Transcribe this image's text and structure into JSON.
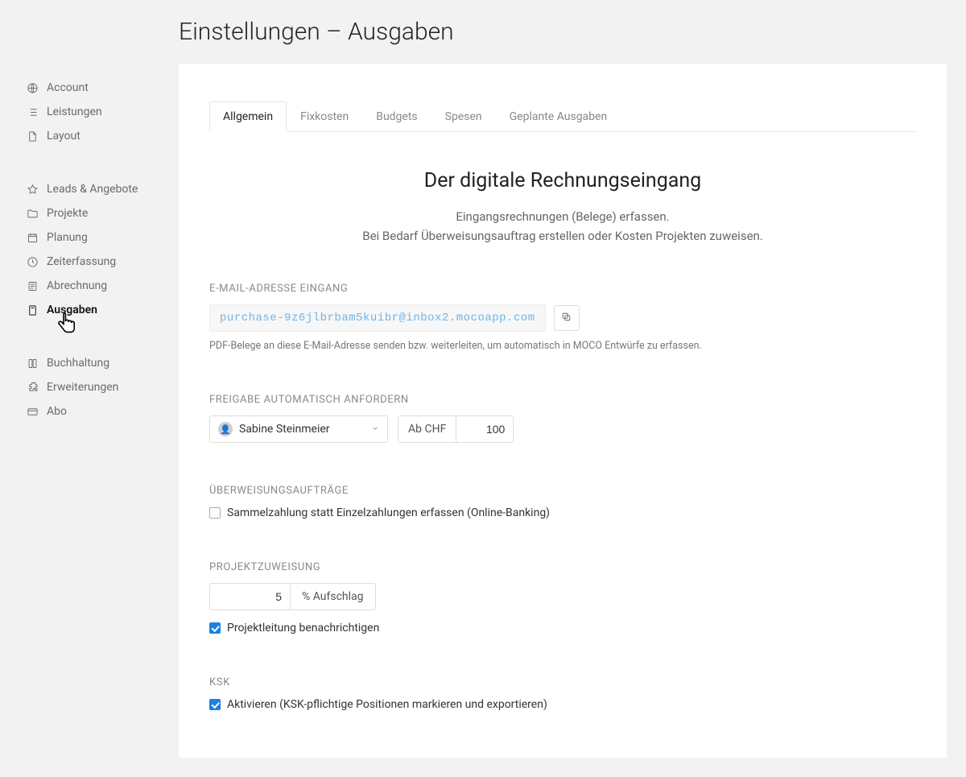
{
  "page_title": "Einstellungen – Ausgaben",
  "sidebar": {
    "group1": [
      {
        "label": "Account"
      },
      {
        "label": "Leistungen"
      },
      {
        "label": "Layout"
      }
    ],
    "group2": [
      {
        "label": "Leads & Angebote"
      },
      {
        "label": "Projekte"
      },
      {
        "label": "Planung"
      },
      {
        "label": "Zeiterfassung"
      },
      {
        "label": "Abrechnung"
      },
      {
        "label": "Ausgaben"
      }
    ],
    "group3": [
      {
        "label": "Buchhaltung"
      },
      {
        "label": "Erweiterungen"
      },
      {
        "label": "Abo"
      }
    ]
  },
  "tabs": [
    {
      "label": "Allgemein"
    },
    {
      "label": "Fixkosten"
    },
    {
      "label": "Budgets"
    },
    {
      "label": "Spesen"
    },
    {
      "label": "Geplante Ausgaben"
    }
  ],
  "hero": {
    "title": "Der digitale Rechnungseingang",
    "line1": "Eingangsrechnungen (Belege) erfassen.",
    "line2": "Bei Bedarf Überweisungsauftrag erstellen oder Kosten Projekten zuweisen."
  },
  "email_section": {
    "label": "E-MAIL-ADRESSE EINGANG",
    "address": "purchase-9z6jlbrbam5kuibr@inbox2.mocoapp.com",
    "help": "PDF-Belege an diese E-Mail-Adresse senden bzw. weiterleiten, um automatisch in MOCO Entwürfe zu erfassen."
  },
  "approval_section": {
    "label": "FREIGABE AUTOMATISCH ANFORDERN",
    "person": "Sabine Steinmeier",
    "threshold_prefix": "Ab CHF",
    "threshold_value": "100"
  },
  "transfer_section": {
    "label": "ÜBERWEISUNGSAUFTRÄGE",
    "checkbox_label": "Sammelzahlung statt Einzelzahlungen erfassen (Online-Banking)",
    "checked": false
  },
  "project_section": {
    "label": "PROJEKTZUWEISUNG",
    "markup_value": "5",
    "markup_suffix": "% Aufschlag",
    "notify_label": "Projektleitung benachrichtigen",
    "notify_checked": true
  },
  "ksk_section": {
    "label": "KSK",
    "checkbox_label": "Aktivieren (KSK-pflichtige Positionen markieren und exportieren)",
    "checked": true
  }
}
